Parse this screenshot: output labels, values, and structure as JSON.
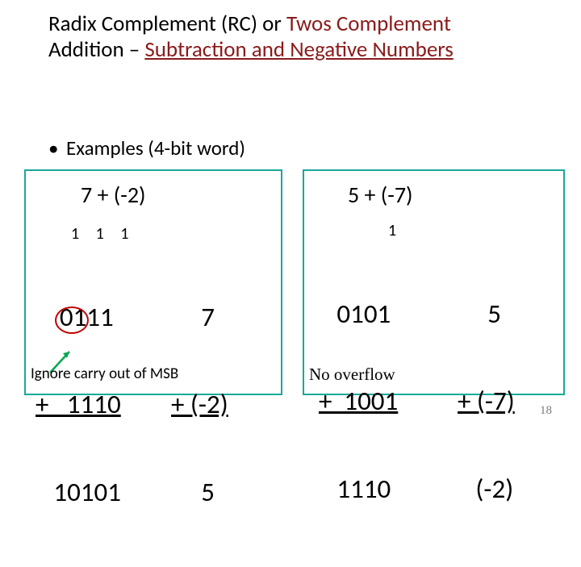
{
  "title": {
    "l1_plain": "Radix Complement (RC) or ",
    "l1_red": "Twos Complement",
    "l2_plain": "Addition – ",
    "l2_red": "Subtraction and Negative Numbers"
  },
  "bullet": "Examples (4-bit word)",
  "ex1": {
    "heading": "7 + (-2)",
    "carries": "1 1 1",
    "bin_r1": "    0111",
    "bin_r2": "+   1110",
    "bin_r3": "   10101",
    "dec_r1": "     7",
    "dec_r2": "+ (-2)",
    "dec_r3": "     5",
    "note": "Ignore carry out of MSB"
  },
  "ex2": {
    "heading": "5 + (-7)",
    "carries": "1",
    "bin_r1": "   0101",
    "bin_r2": "+  1001",
    "bin_r3": "   1110",
    "dec_r1": "     5",
    "dec_r2": "+ (-7)",
    "dec_r3": "   (-2)",
    "note": "No overflow"
  },
  "page_number": "18"
}
